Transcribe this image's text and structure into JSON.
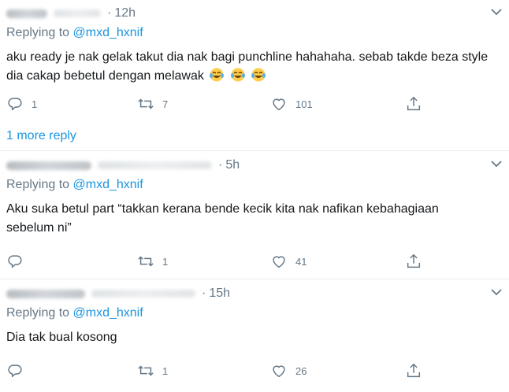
{
  "tweets": [
    {
      "name": "",
      "handle": "",
      "time": "12h",
      "replying_label": "Replying to",
      "replying_handle": "@mxd_hxnif",
      "text": "aku ready je nak gelak takut dia nak bagi punchline hahahaha. sebab takde beza style dia cakap bebetul dengan melawak",
      "emojis": [
        "face-with-tears-of-joy",
        "face-with-tears-of-joy",
        "face-with-tears-of-joy"
      ],
      "reply_count": "1",
      "retweet_count": "7",
      "like_count": "101"
    },
    {
      "name": "",
      "handle": "",
      "time": "5h",
      "replying_label": "Replying to",
      "replying_handle": "@mxd_hxnif",
      "text": "Aku suka betul part “takkan kerana bende kecik kita nak nafikan kebahagiaan sebelum ni”",
      "reply_count": "",
      "retweet_count": "1",
      "like_count": "41"
    },
    {
      "name": "",
      "handle": "",
      "time": "15h",
      "replying_label": "Replying to",
      "replying_handle": "@mxd_hxnif",
      "text": "Dia tak bual kosong",
      "reply_count": "",
      "retweet_count": "1",
      "like_count": "26"
    }
  ],
  "more_replies_label": "1 more reply",
  "colors": {
    "link": "#1b95e0",
    "muted": "#657786",
    "text": "#14171a",
    "divider": "#e6ecf0"
  },
  "icons": [
    "reply-icon",
    "retweet-icon",
    "like-icon",
    "share-icon",
    "chevron-down-icon"
  ]
}
